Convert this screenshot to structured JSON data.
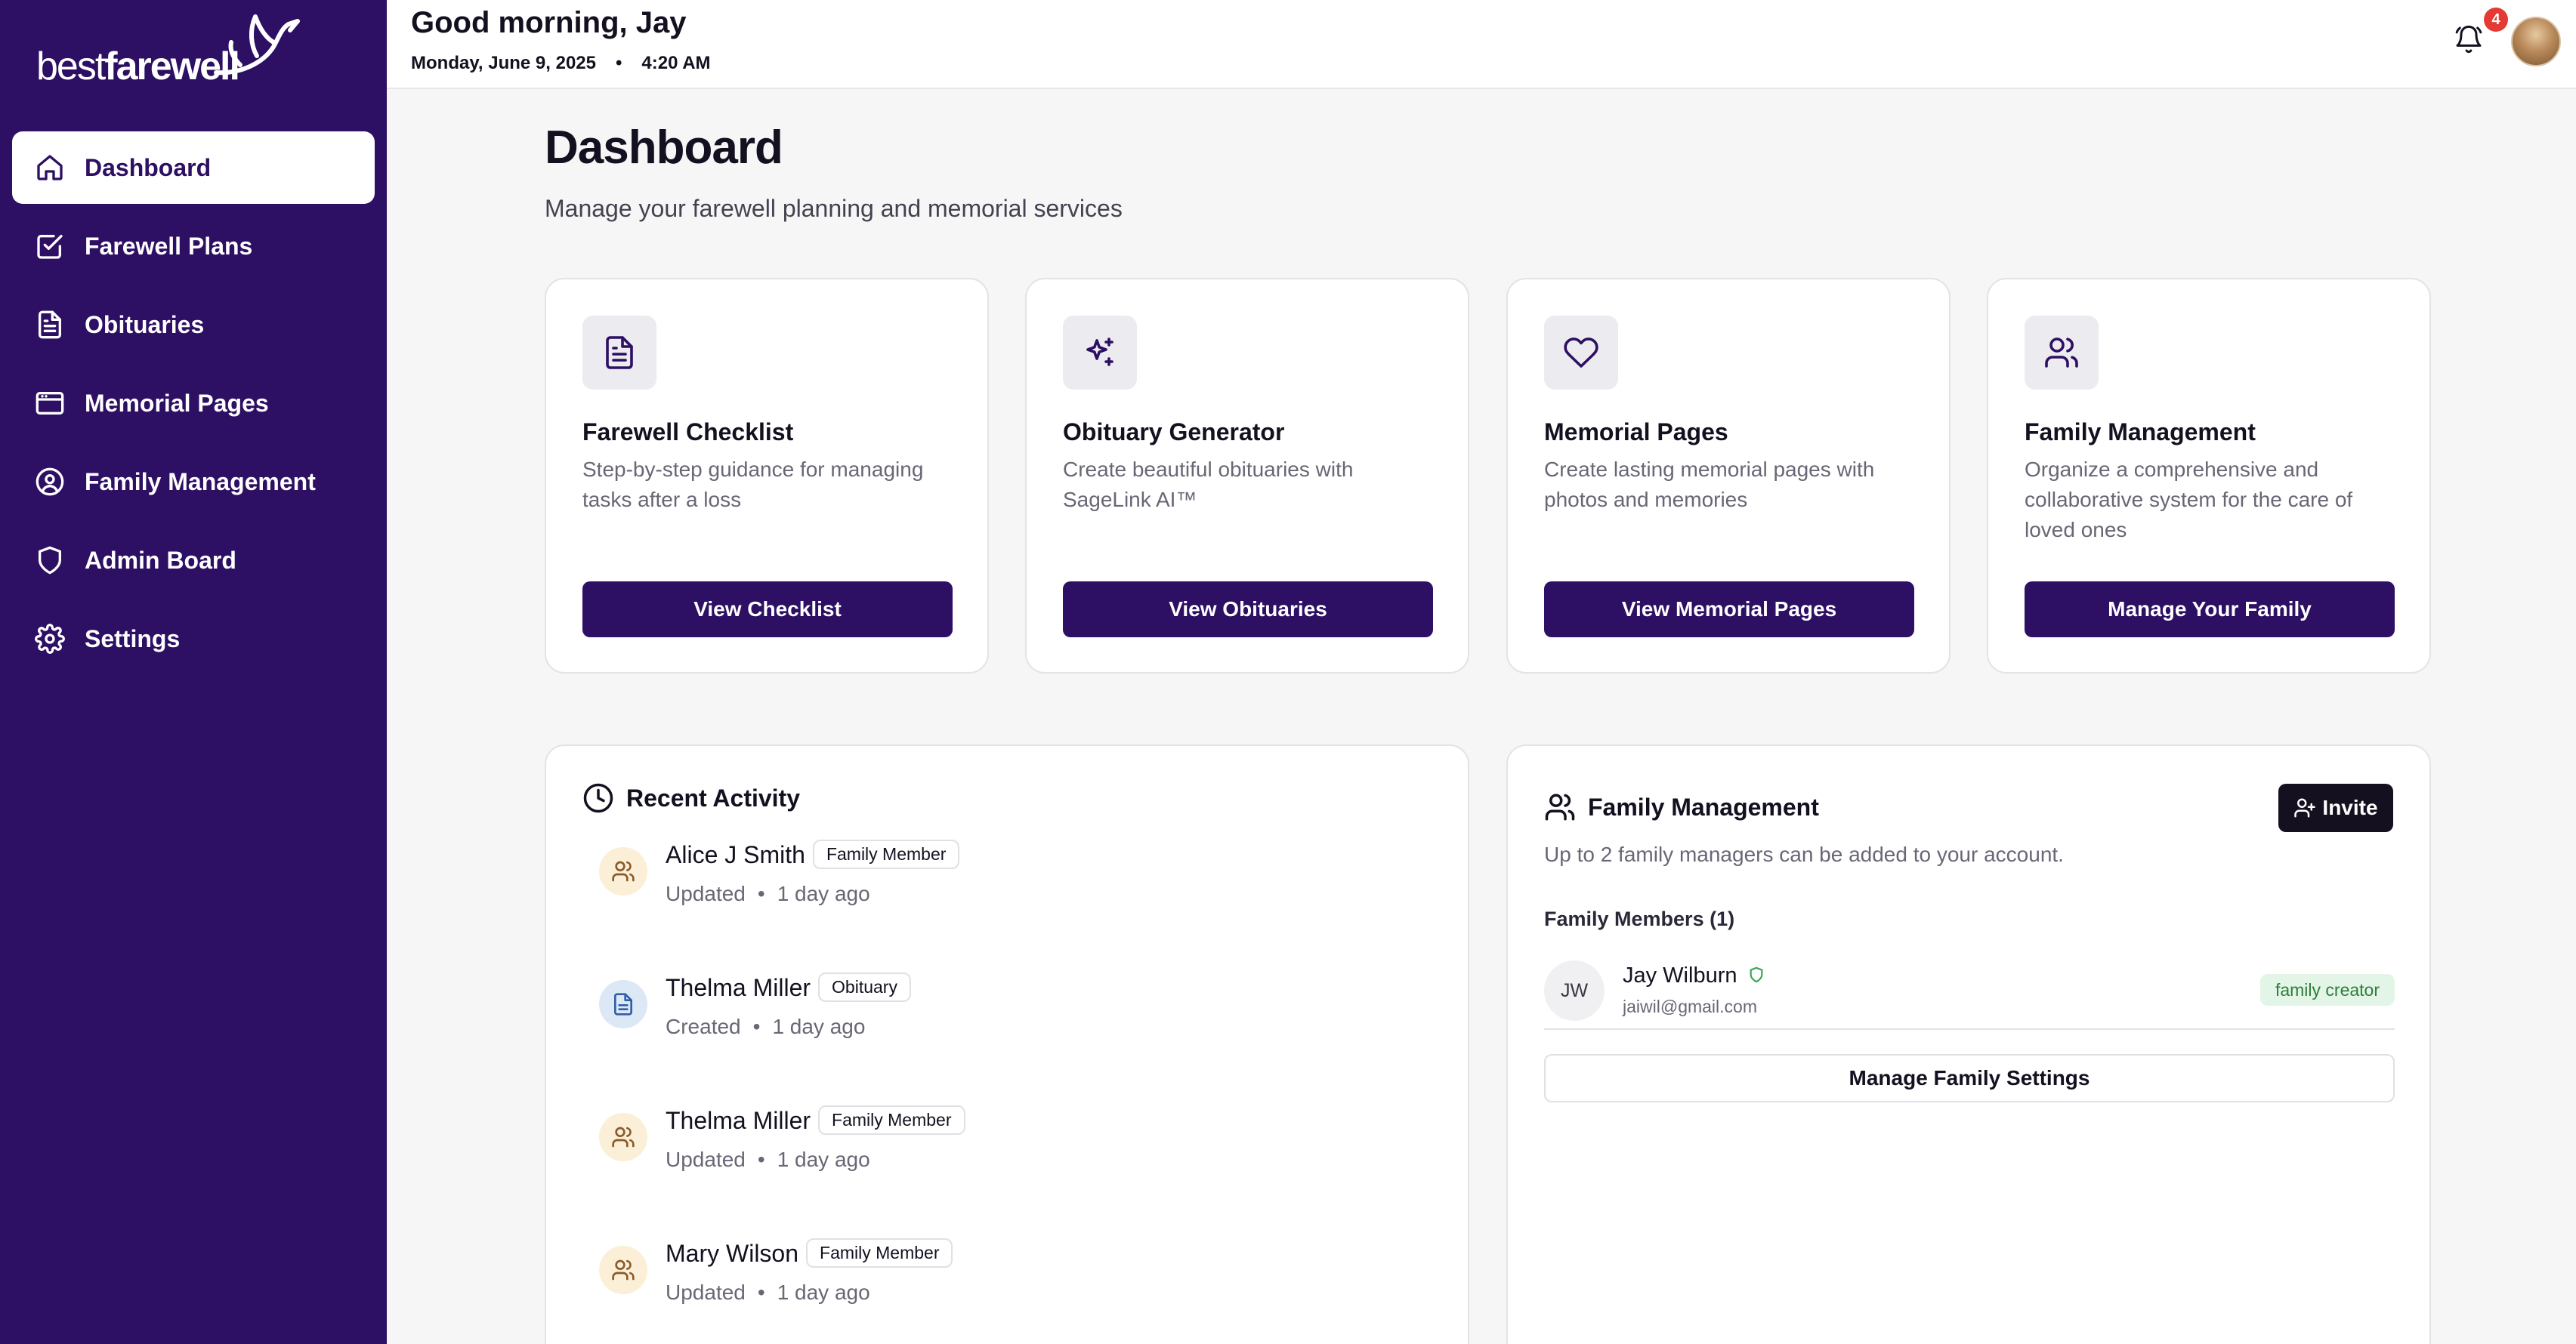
{
  "brand": {
    "logo_light": "best",
    "logo_bold": "farewell"
  },
  "sidebar": {
    "items": [
      {
        "label": "Dashboard",
        "icon": "home-icon",
        "active": true
      },
      {
        "label": "Farewell Plans",
        "icon": "checkbox-icon"
      },
      {
        "label": "Obituaries",
        "icon": "document-icon"
      },
      {
        "label": "Memorial Pages",
        "icon": "browser-window-icon"
      },
      {
        "label": "Family Management",
        "icon": "user-circle-icon"
      },
      {
        "label": "Admin Board",
        "icon": "shield-icon"
      },
      {
        "label": "Settings",
        "icon": "gear-icon"
      }
    ]
  },
  "header": {
    "greeting": "Good morning, Jay",
    "date": "Monday, June 9, 2025",
    "separator": "•",
    "time": "4:20 AM",
    "notification_count": "4"
  },
  "main": {
    "title": "Dashboard",
    "subtitle": "Manage your farewell planning and memorial services"
  },
  "cards": [
    {
      "icon": "document-icon",
      "title": "Farewell Checklist",
      "description": "Step-by-step guidance for managing tasks after a loss",
      "button": "View Checklist"
    },
    {
      "icon": "sparkles-icon",
      "title": "Obituary Generator",
      "description": "Create beautiful obituaries with SageLink AI™",
      "button": "View Obituaries"
    },
    {
      "icon": "heart-icon",
      "title": "Memorial Pages",
      "description": "Create lasting memorial pages with photos and memories",
      "button": "View Memorial Pages"
    },
    {
      "icon": "users-icon",
      "title": "Family Management",
      "description": "Organize a comprehensive and collaborative system for the care of loved ones",
      "button": "Manage Your Family"
    }
  ],
  "activity": {
    "title": "Recent Activity",
    "items": [
      {
        "name": "Alice J Smith",
        "tag": "Family Member",
        "action": "Updated",
        "time": "1 day ago",
        "kind": "member"
      },
      {
        "name": "Thelma Miller",
        "tag": "Obituary",
        "action": "Created",
        "time": "1 day ago",
        "kind": "obituary"
      },
      {
        "name": "Thelma Miller",
        "tag": "Family Member",
        "action": "Updated",
        "time": "1 day ago",
        "kind": "member"
      },
      {
        "name": "Mary Wilson",
        "tag": "Family Member",
        "action": "Updated",
        "time": "1 day ago",
        "kind": "member"
      }
    ]
  },
  "family": {
    "title": "Family Management",
    "invite_label": "Invite",
    "note": "Up to 2 family managers can be added to your account.",
    "members_heading": "Family Members (1)",
    "members": [
      {
        "initials": "JW",
        "name": "Jay Wilburn",
        "email": "jaiwil@gmail.com",
        "role": "family creator"
      }
    ],
    "settings_button": "Manage Family Settings"
  },
  "colors": {
    "brand_purple": "#2d0f63",
    "notification_red": "#e53935",
    "role_green": "#2e7d3a"
  }
}
